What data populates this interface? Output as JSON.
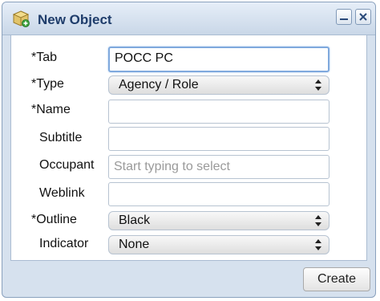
{
  "window": {
    "title": "New Object"
  },
  "form": {
    "tab": {
      "label": "*Tab",
      "value": "POCC PC"
    },
    "type": {
      "label": "*Type",
      "selected": "Agency / Role"
    },
    "name": {
      "label": "*Name",
      "value": ""
    },
    "subtitle": {
      "label": "Subtitle",
      "value": ""
    },
    "occupant": {
      "label": "Occupant",
      "placeholder": "Start typing to select"
    },
    "weblink": {
      "label": "Weblink",
      "value": ""
    },
    "outline": {
      "label": "*Outline",
      "selected": "Black"
    },
    "indicator": {
      "label": "Indicator",
      "selected": "None"
    }
  },
  "footer": {
    "create_label": "Create"
  },
  "icons": {
    "title_icon": "new-object-box-icon",
    "minimize": "minimize-icon",
    "close": "close-icon",
    "select_arrow": "updown-arrows-icon"
  }
}
